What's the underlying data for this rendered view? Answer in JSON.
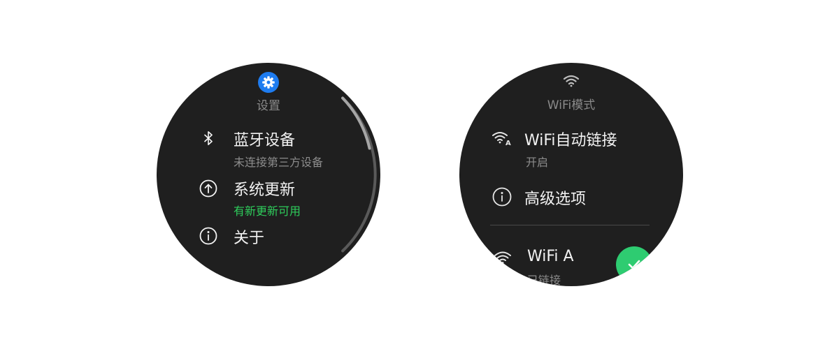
{
  "left_watch": {
    "header": {
      "icon": "gear-icon",
      "title": "设置",
      "accent_color": "#1e7cf0"
    },
    "items": [
      {
        "icon": "bluetooth-icon",
        "label": "蓝牙设备",
        "subtitle": "未连接第三方设备"
      },
      {
        "icon": "arrow-up-circle-icon",
        "label": "系统更新",
        "subtitle": "有新更新可用",
        "subtitle_color": "#2ecc5b"
      },
      {
        "icon": "info-circle-icon",
        "label": "关于"
      }
    ]
  },
  "right_watch": {
    "header": {
      "icon": "wifi-icon",
      "title": "WiFi模式"
    },
    "items": [
      {
        "icon": "wifi-auto-icon",
        "label": "WiFi自动链接",
        "subtitle": "开启"
      },
      {
        "icon": "info-circle-icon",
        "label": "高级选项"
      }
    ],
    "networks": [
      {
        "icon": "wifi-icon",
        "name": "WiFi A",
        "status": "已链接",
        "action_icon": "check-icon",
        "action_color": "#2ecc71"
      }
    ]
  }
}
